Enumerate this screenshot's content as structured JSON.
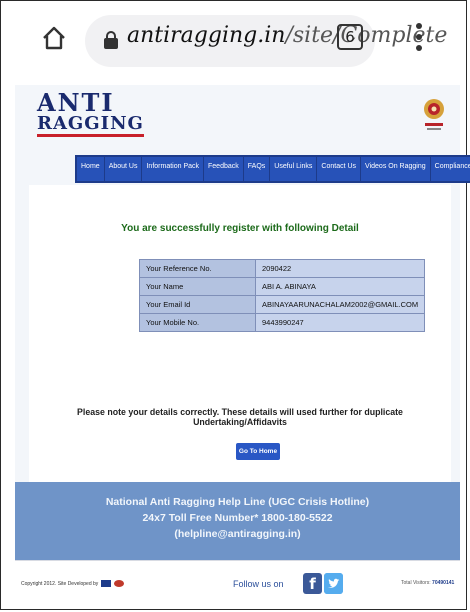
{
  "browser": {
    "url_host": "antiragging.in",
    "url_path": "/site/Complete",
    "tab_count": "6"
  },
  "site": {
    "logo_line1": "ANTI",
    "logo_line2": "RAGGING"
  },
  "nav": {
    "items": [
      "Home",
      "About Us",
      "Information Pack",
      "Feedback",
      "FAQs",
      "Useful Links",
      "Contact Us",
      "Videos On Ragging",
      "Compliance"
    ]
  },
  "main": {
    "success_message": "You are successfully register with following Detail",
    "details": [
      {
        "label": "Your Reference No.",
        "value": "2090422"
      },
      {
        "label": "Your Name",
        "value": "ABI A. ABINAYA"
      },
      {
        "label": "Your Email Id",
        "value": "ABINAYAARUNACHALAM2002@GMAIL.COM"
      },
      {
        "label": "Your Mobile No.",
        "value": "9443990247"
      }
    ],
    "note": "Please note your details correctly. These details will used further for duplicate Undertaking/Affidavits",
    "home_button": "Go To Home"
  },
  "helpline": {
    "line1": "National Anti Ragging Help Line (UGC Crisis Hotline)",
    "line2": "24x7 Toll Free Number* 1800-180-5522",
    "line3": "(helpline@antiragging.in)"
  },
  "footer": {
    "copyright": "Copyright 2012. Site Developed by",
    "follow": "Follow us on",
    "visitors_label": "Total Visitors:",
    "visitors_count": "70490141",
    "icons": [
      "facebook-icon",
      "twitter-icon"
    ]
  },
  "colors": {
    "nav": "#2752b8",
    "helpline_bg": "#6f94c8",
    "success_text": "#1c6a1a"
  }
}
